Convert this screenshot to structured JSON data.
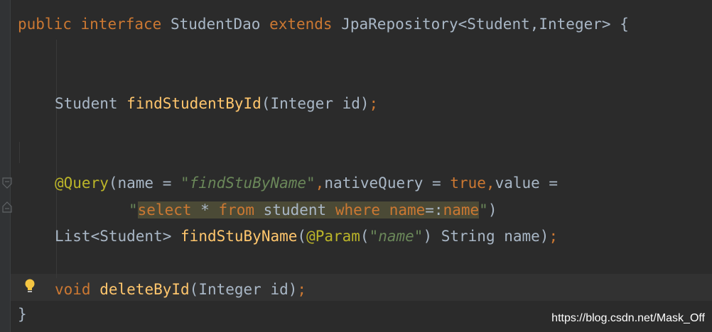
{
  "editor": {
    "lines": {
      "l1": {
        "public": "public",
        "interface": "interface",
        "name": "StudentDao",
        "extends": "extends",
        "parent": "JpaRepository<Student,Integer>",
        "brace": "{"
      },
      "l2": {
        "ret": "Student",
        "fn": "findStudentById",
        "args": "(Integer id)",
        "semi": ";"
      },
      "l3": {
        "annotation": "@Query",
        "open": "(name = ",
        "name_str": "\"findStuByName\"",
        "comma1": ",",
        "native": "nativeQuery = ",
        "true_kw": "true",
        "comma2": ",",
        "value": "value ="
      },
      "l4": {
        "q_open": "\"",
        "select": "select",
        "star": " * ",
        "from": "from",
        "table": " student ",
        "where": "where",
        "sp": " ",
        "col": "name",
        "eq": "=:",
        "param": "name",
        "q_close": "\"",
        "paren": ")"
      },
      "l5": {
        "ret": "List<Student>",
        "fn": "findStuByName",
        "open": "(",
        "annotation": "@Param",
        "arg_open": "(",
        "arg_str": "\"name\"",
        "arg_close": ") String name)",
        "semi": ";"
      },
      "l6": {
        "void": "void",
        "fn": "deleteById",
        "args": "(Integer id)",
        "semi": ";"
      },
      "l7": {
        "brace": "}"
      }
    },
    "colors": {
      "background": "#2b2b2b",
      "keyword": "#cc7832",
      "function": "#ffc66d",
      "string": "#6a8759",
      "annotation": "#bbb529",
      "plain": "#a9b7c6"
    },
    "icons": [
      "fold-start-icon",
      "fold-end-icon",
      "lightbulb-icon"
    ]
  },
  "watermark": "https://blog.csdn.net/Mask_Off"
}
